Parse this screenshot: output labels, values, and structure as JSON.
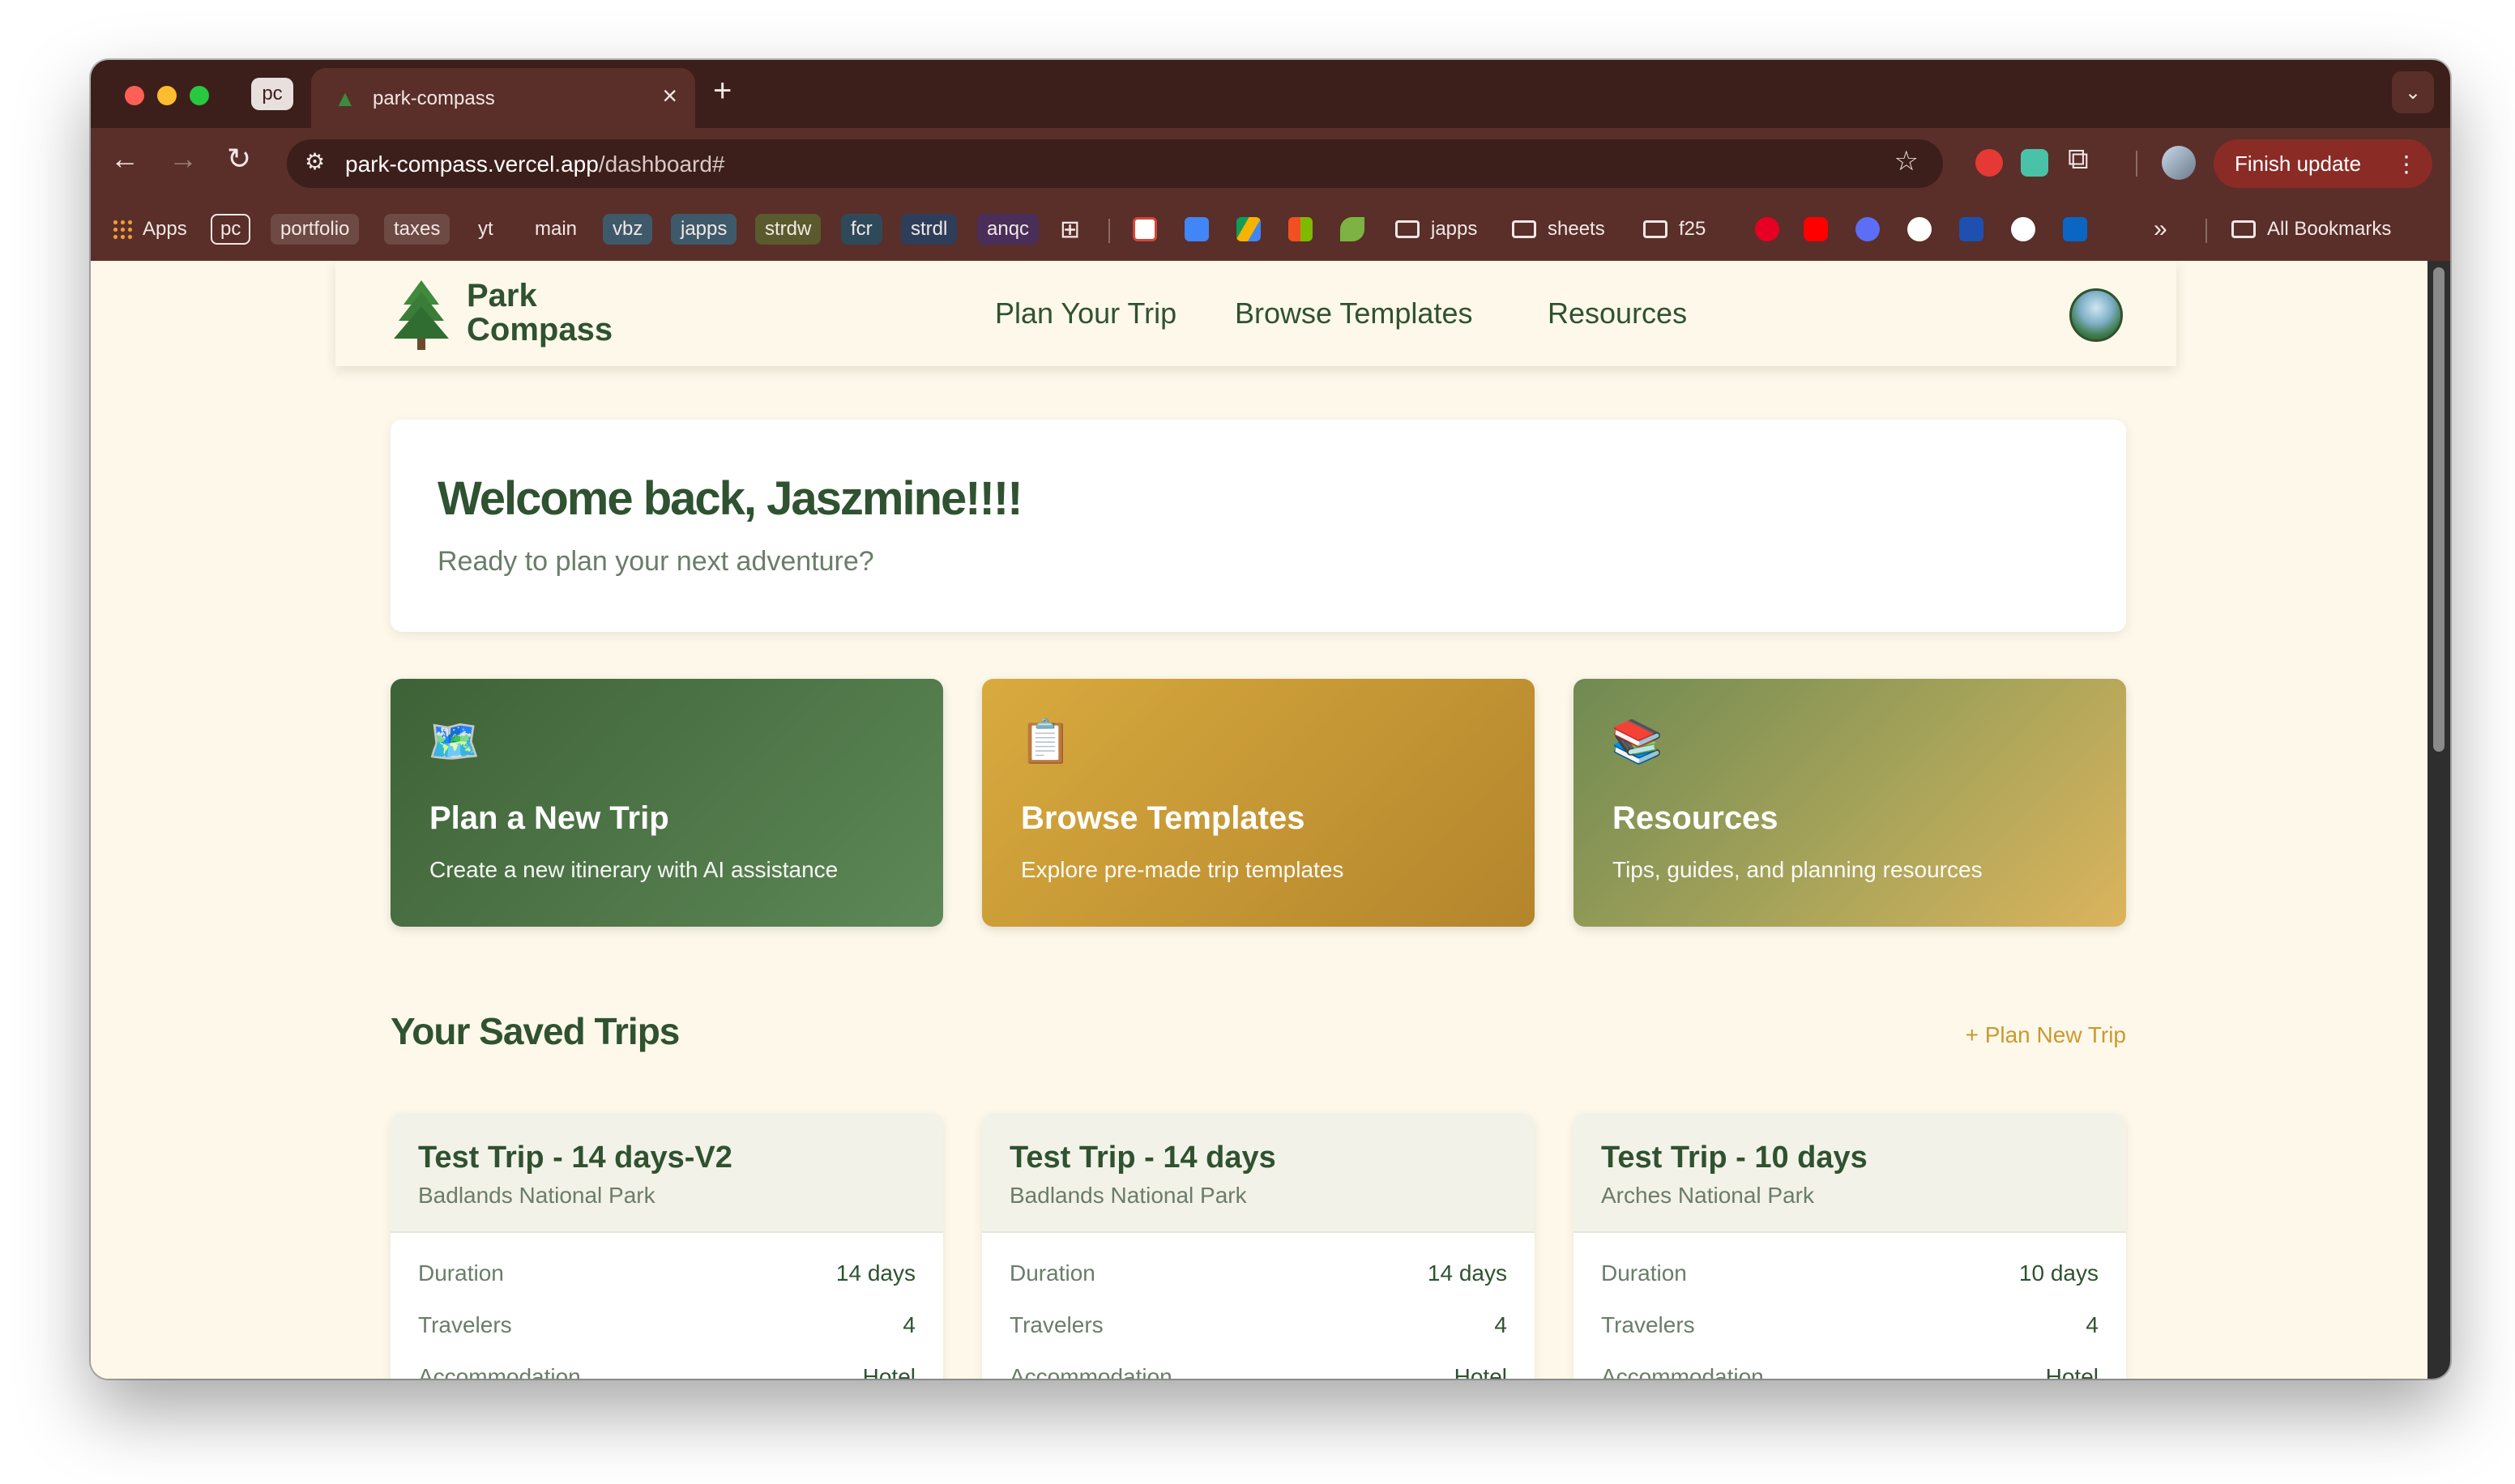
{
  "browser": {
    "pinned_tab": "pc",
    "active_tab_title": "park-compass",
    "url_host": "park-compass.vercel.app",
    "url_path": "/dashboard#",
    "finish_update": "Finish update",
    "bookmarks": {
      "apps": "Apps",
      "chips": [
        "pc",
        "portfolio",
        "taxes",
        "yt",
        "main",
        "vbz",
        "japps",
        "strdw",
        "fcr",
        "strdl",
        "anqc"
      ],
      "folders": [
        "japps",
        "sheets",
        "f25"
      ],
      "overflow": "»",
      "all_bookmarks": "All Bookmarks"
    }
  },
  "site": {
    "logo_line1": "Park",
    "logo_line2": "Compass",
    "nav": [
      "Plan Your Trip",
      "Browse Templates",
      "Resources"
    ]
  },
  "welcome": {
    "heading": "Welcome back, Jaszmine!!!!",
    "subtitle": "Ready to plan your next adventure?"
  },
  "actions": [
    {
      "emoji": "🗺️",
      "title": "Plan a New Trip",
      "desc": "Create a new itinerary with AI assistance"
    },
    {
      "emoji": "📋",
      "title": "Browse Templates",
      "desc": "Explore pre-made trip templates"
    },
    {
      "emoji": "📚",
      "title": "Resources",
      "desc": "Tips, guides, and planning resources"
    }
  ],
  "saved": {
    "title": "Your Saved Trips",
    "plan_new": "+ Plan New Trip",
    "trips": [
      {
        "name": "Test Trip - 14 days-V2",
        "park": "Badlands National Park",
        "duration_label": "Duration",
        "duration": "14 days",
        "travelers_label": "Travelers",
        "travelers": "4",
        "accom_label": "Accommodation",
        "accom": "Hotel"
      },
      {
        "name": "Test Trip - 14 days",
        "park": "Badlands National Park",
        "duration_label": "Duration",
        "duration": "14 days",
        "travelers_label": "Travelers",
        "travelers": "4",
        "accom_label": "Accommodation",
        "accom": "Hotel"
      },
      {
        "name": "Test Trip - 10 days",
        "park": "Arches National Park",
        "duration_label": "Duration",
        "duration": "10 days",
        "travelers_label": "Travelers",
        "travelers": "4",
        "accom_label": "Accommodation",
        "accom": "Hotel"
      }
    ]
  },
  "colors": {
    "brand_green": "#2f5230",
    "gold": "#c99a30",
    "page_bg": "#fdf8ea",
    "browser_dark": "#3c1e1b",
    "browser_toolbar": "#5a2e29"
  }
}
